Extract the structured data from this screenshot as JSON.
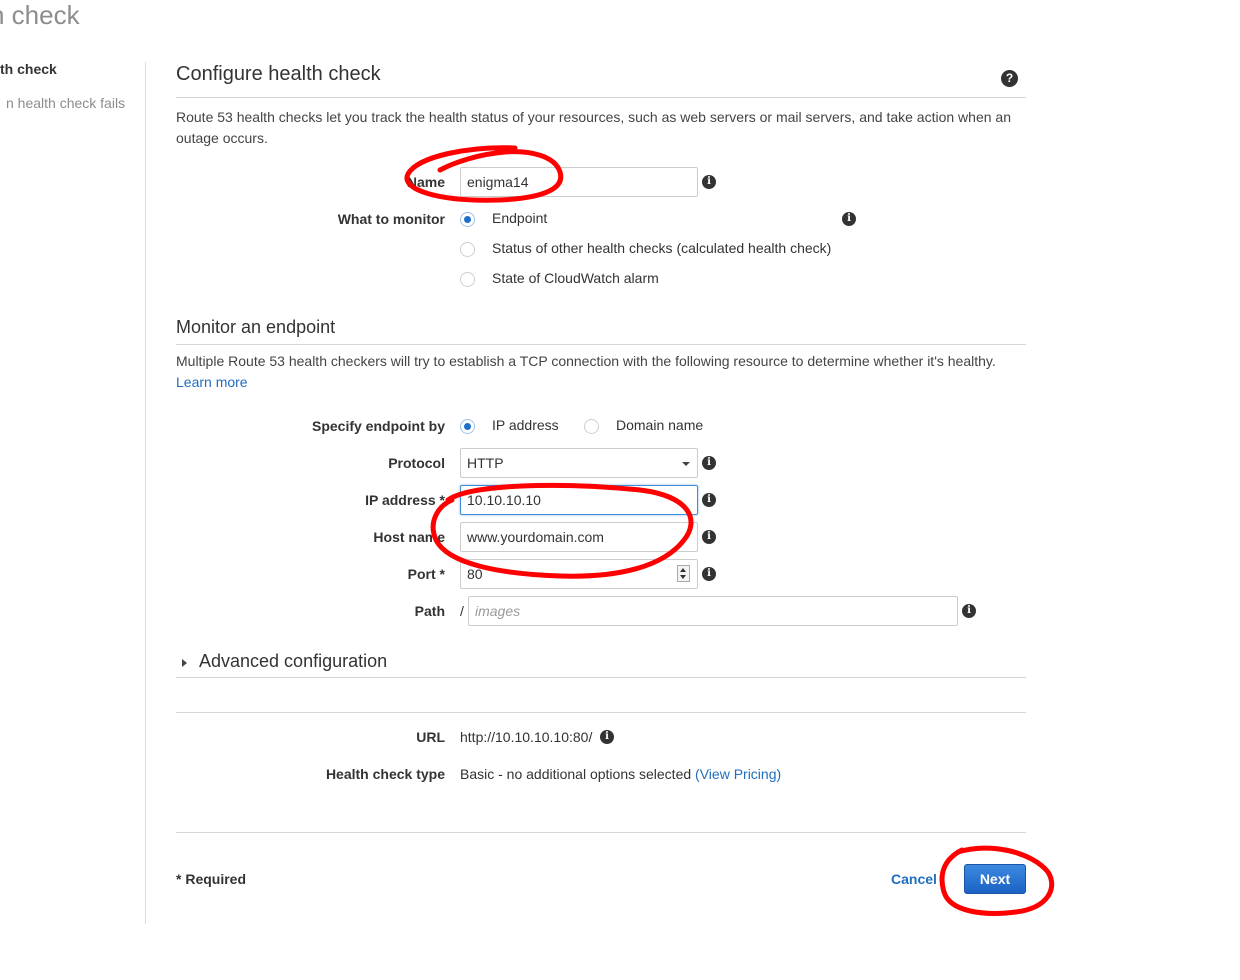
{
  "page": {
    "title": "n check",
    "steps": [
      "th check",
      "n health check fails"
    ]
  },
  "configure": {
    "title": "Configure health check",
    "description": "Route 53 health checks let you track the health status of your resources, such as web servers or mail servers, and take action when an outage occurs.",
    "name_label": "Name",
    "name_value": "enigma14",
    "monitor_label": "What to monitor",
    "monitor_options": [
      {
        "label": "Endpoint",
        "selected": true
      },
      {
        "label": "Status of other health checks (calculated health check)",
        "selected": false
      },
      {
        "label": "State of CloudWatch alarm",
        "selected": false
      }
    ]
  },
  "endpoint": {
    "title": "Monitor an endpoint",
    "description": "Multiple Route 53 health checkers will try to establish a TCP connection with the following resource to determine whether it's healthy.",
    "learn_more": "Learn more",
    "specify_label": "Specify endpoint by",
    "specify_options": [
      {
        "label": "IP address",
        "selected": true
      },
      {
        "label": "Domain name",
        "selected": false
      }
    ],
    "protocol_label": "Protocol",
    "protocol_value": "HTTP",
    "ip_label": "IP address",
    "ip_value": "10.10.10.10",
    "host_label": "Host name",
    "host_value": "www.yourdomain.com",
    "port_label": "Port",
    "port_value": "80",
    "path_label": "Path",
    "path_prefix": "/",
    "path_placeholder": "images",
    "required_marker": "*"
  },
  "advanced": {
    "label": "Advanced configuration"
  },
  "summary": {
    "url_label": "URL",
    "url_value": "http://10.10.10.10:80/",
    "type_label": "Health check type",
    "type_value": "Basic - no additional options selected",
    "pricing_link": "(View Pricing)"
  },
  "footer": {
    "required_note": "* Required",
    "cancel": "Cancel",
    "next": "Next"
  },
  "icons": {
    "info": "info-icon",
    "help": "help-icon"
  },
  "colors": {
    "accent": "#1f6ebf",
    "primary_button": "#1a62c5",
    "annotation": "#ff0000"
  }
}
